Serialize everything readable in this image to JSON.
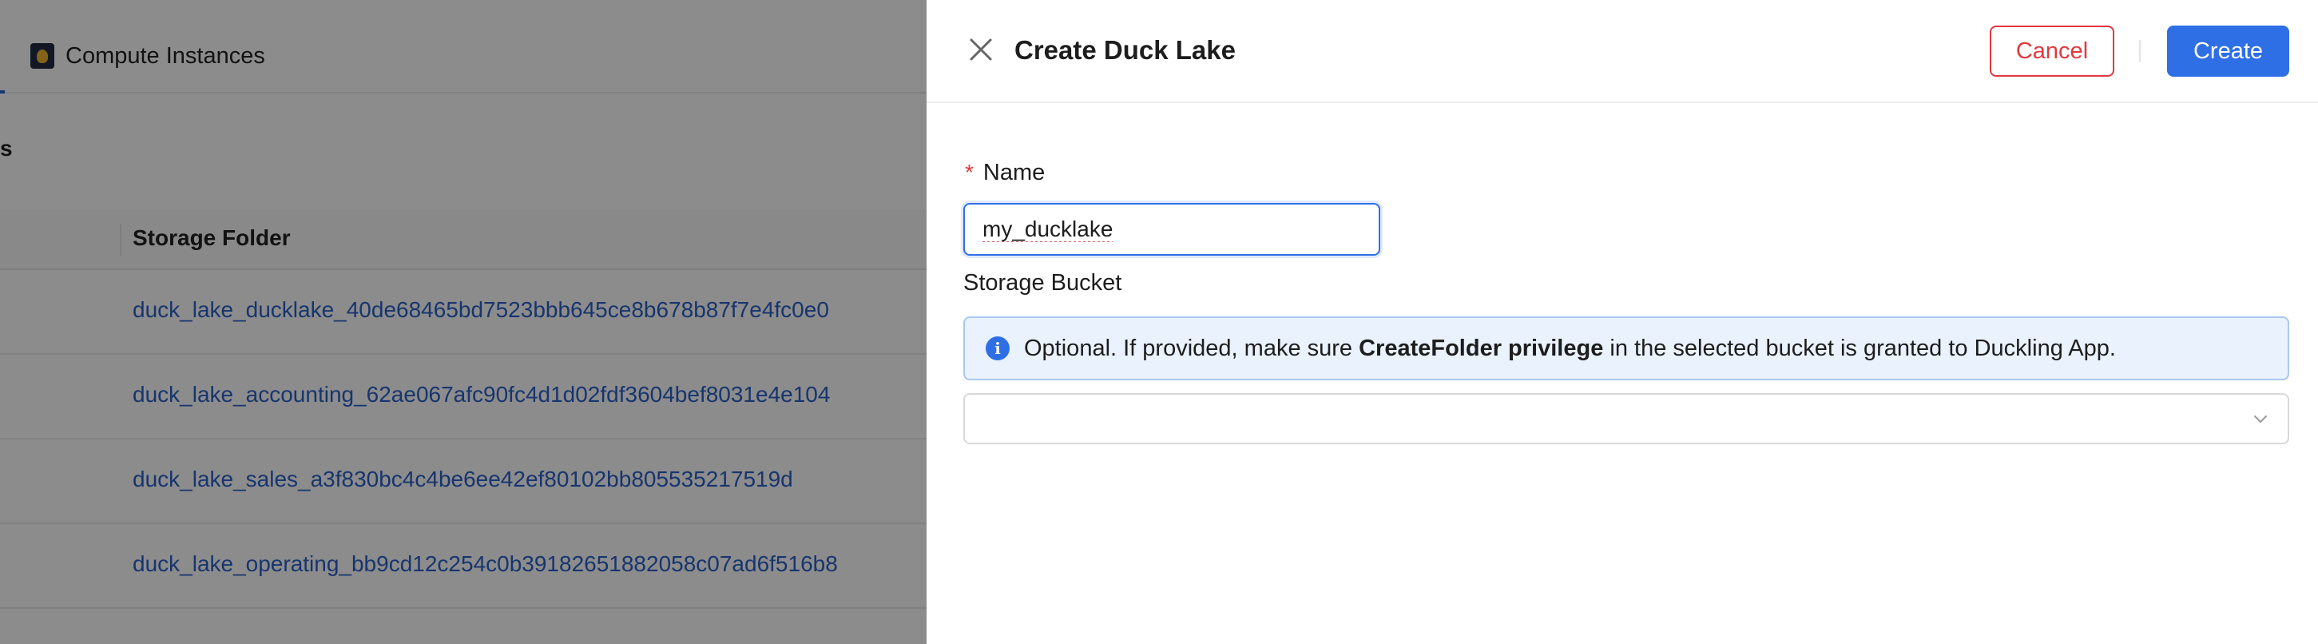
{
  "background": {
    "tab": {
      "label": "Compute Instances",
      "icon": "duckling-app-icon"
    },
    "section_fragment": "s",
    "table": {
      "column_header": "Storage Folder",
      "rows": [
        "duck_lake_ducklake_40de68465bd7523bbb645ce8b678b87f7e4fc0e0",
        "duck_lake_accounting_62ae067afc90fc4d1d02fdf3604bef8031e4e104",
        "duck_lake_sales_a3f830bc4c4be6ee42ef80102bb805535217519d",
        "duck_lake_operating_bb9cd12c254c0b39182651882058c07ad6f516b8"
      ]
    }
  },
  "drawer": {
    "title": "Create Duck Lake",
    "close_icon": "close-icon",
    "cancel_label": "Cancel",
    "create_label": "Create",
    "form": {
      "name": {
        "label": "Name",
        "required_mark": "*",
        "value": "my_ducklake"
      },
      "storage_bucket": {
        "label": "Storage Bucket",
        "value": "",
        "alert": {
          "icon": "info-icon",
          "text_before": "Optional. If provided, make sure ",
          "text_bold": "CreateFolder privilege",
          "text_after": " in the selected bucket is granted to Duckling App."
        }
      }
    }
  },
  "colors": {
    "primary": "#2f6fe6",
    "danger": "#e0393e",
    "link": "#2a62c9",
    "alert_bg": "#e9f2fd",
    "alert_border": "#a9c9f2"
  }
}
